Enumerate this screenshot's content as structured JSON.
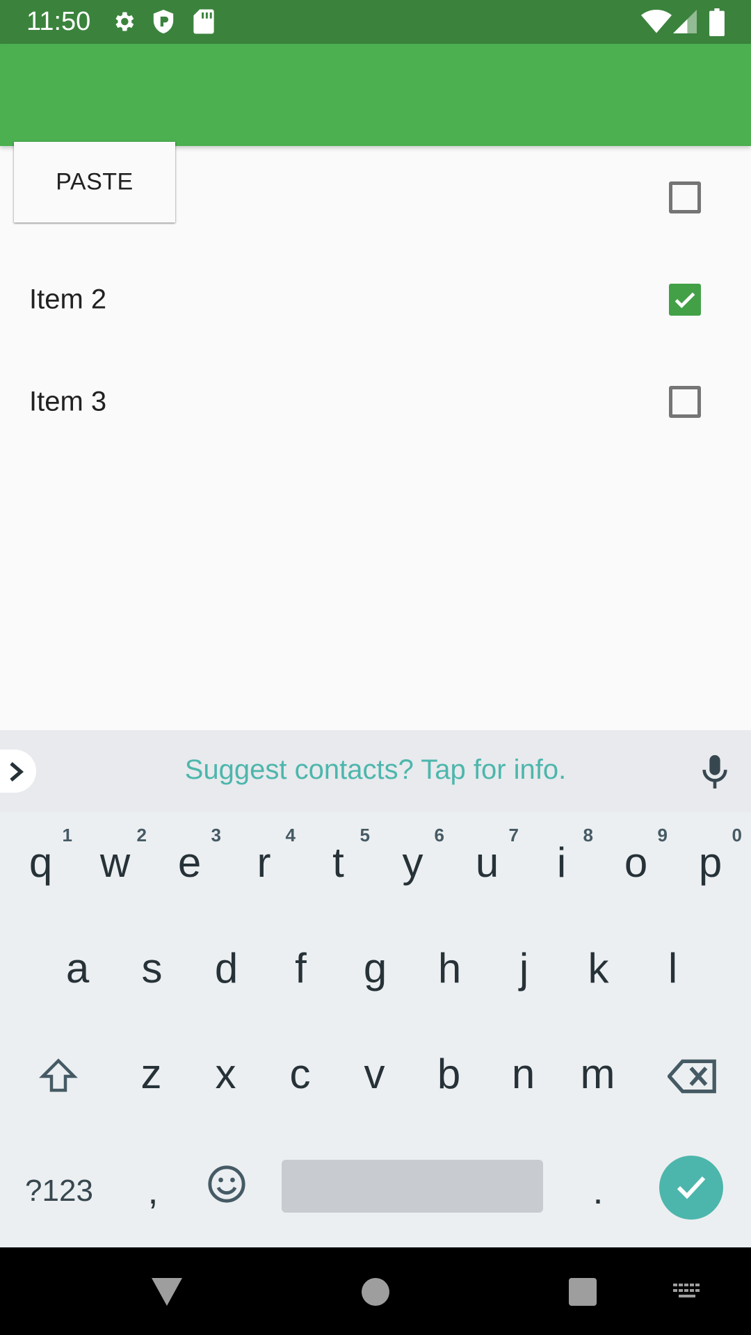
{
  "status_bar": {
    "time": "11:50",
    "left_icons": [
      "settings-icon",
      "shield-icon",
      "sd-card-icon"
    ],
    "right_icons": [
      "wifi-icon",
      "cell-signal-icon",
      "battery-icon"
    ],
    "background_color": "#3b833d"
  },
  "app_bar": {
    "background_color": "#4caf50"
  },
  "paste_popup": {
    "label": "PASTE"
  },
  "list": {
    "items": [
      {
        "label": "",
        "checked": false
      },
      {
        "label": "Item 2",
        "checked": true
      },
      {
        "label": "Item 3",
        "checked": false
      }
    ]
  },
  "keyboard": {
    "suggestion": "Suggest contacts? Tap for info.",
    "row1": [
      {
        "key": "q",
        "hint": "1"
      },
      {
        "key": "w",
        "hint": "2"
      },
      {
        "key": "e",
        "hint": "3"
      },
      {
        "key": "r",
        "hint": "4"
      },
      {
        "key": "t",
        "hint": "5"
      },
      {
        "key": "y",
        "hint": "6"
      },
      {
        "key": "u",
        "hint": "7"
      },
      {
        "key": "i",
        "hint": "8"
      },
      {
        "key": "o",
        "hint": "9"
      },
      {
        "key": "p",
        "hint": "0"
      }
    ],
    "row2": [
      "a",
      "s",
      "d",
      "f",
      "g",
      "h",
      "j",
      "k",
      "l"
    ],
    "row3": [
      "z",
      "x",
      "c",
      "v",
      "b",
      "n",
      "m"
    ],
    "symbols_label": "?123",
    "comma_label": ",",
    "period_label": ".",
    "accent_color": "#4db6ac"
  },
  "nav_bar": {
    "buttons": [
      "back-icon",
      "home-icon",
      "recents-icon",
      "keyboard-switch-icon"
    ]
  }
}
